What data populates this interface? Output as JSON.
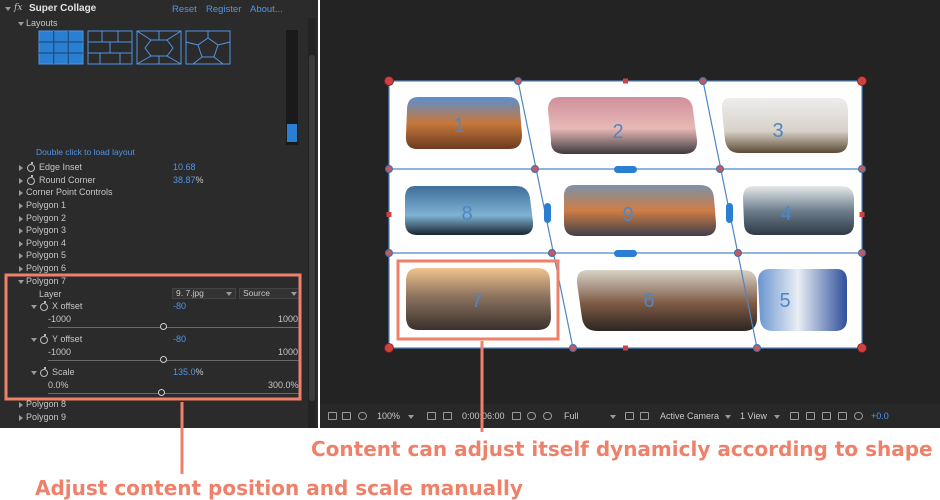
{
  "effect": {
    "fx": "fx",
    "name": "Super Collage",
    "reset": "Reset",
    "register": "Register",
    "about": "About..."
  },
  "layouts": {
    "label": "Layouts",
    "hint": "Double click to load layout"
  },
  "properties": {
    "edge_inset": {
      "label": "Edge Inset",
      "value": "10.68"
    },
    "round_corner": {
      "label": "Round Corner",
      "value": "38.87",
      "unit": "%"
    },
    "corner_point_controls": "Corner Point Controls",
    "polygons_before": [
      "Polygon 1",
      "Polygon 2",
      "Polygon 3",
      "Polygon 4",
      "Polygon 5",
      "Polygon 6"
    ],
    "polygon7": {
      "label": "Polygon 7",
      "layer": {
        "label": "Layer",
        "value": "9. 7.jpg",
        "source": "Source"
      },
      "x_offset": {
        "label": "X offset",
        "value": "-80",
        "min": "-1000",
        "max": "1000",
        "level": 0.46
      },
      "y_offset": {
        "label": "Y offset",
        "value": "-80",
        "min": "-1000",
        "max": "1000",
        "level": 0.46
      },
      "scale": {
        "label": "Scale",
        "value": "135.0",
        "unit": "%",
        "min": "0.0%",
        "max": "300.0%",
        "level": 0.45
      }
    },
    "polygons_after": [
      "Polygon 8",
      "Polygon 9"
    ]
  },
  "viewport": {
    "cells": [
      "1",
      "2",
      "3",
      "8",
      "9",
      "4",
      "7",
      "6",
      "5"
    ]
  },
  "toolbar": {
    "zoom": "100%",
    "timecode": "0:00:06:00",
    "resolution": "Full",
    "camera": "Active Camera",
    "views": "1 View",
    "exposure": "+0.0"
  },
  "annotations": {
    "right": "Content can adjust itself dynamicly according to shape",
    "left": "Adjust content position and scale manually"
  },
  "colors": {
    "accent": "#4f96e8",
    "annotation": "#ef8069",
    "handle": "#d04040"
  }
}
